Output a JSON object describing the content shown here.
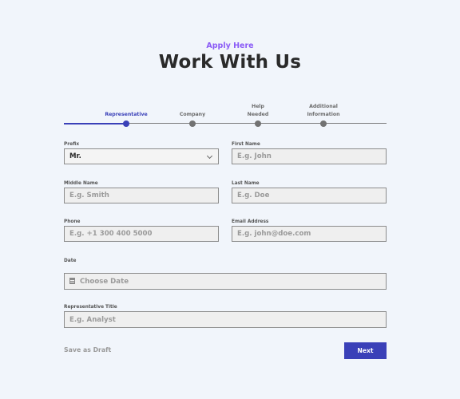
{
  "header": {
    "eyebrow": "Apply Here",
    "title": "Work With Us"
  },
  "stepper": {
    "progress_fraction": 0.195,
    "steps": [
      {
        "line1": "",
        "line2": "Representative",
        "active": true
      },
      {
        "line1": "",
        "line2": "Company",
        "active": false
      },
      {
        "line1": "Help",
        "line2": "Needed",
        "active": false
      },
      {
        "line1": "Additional",
        "line2": "Information",
        "active": false
      }
    ]
  },
  "form": {
    "prefix": {
      "label": "Prefix",
      "value": "Mr."
    },
    "first_name": {
      "label": "First Name",
      "placeholder": "E.g. John"
    },
    "middle_name": {
      "label": "Middle Name",
      "placeholder": "E.g. Smith"
    },
    "last_name": {
      "label": "Last Name",
      "placeholder": "E.g. Doe"
    },
    "phone": {
      "label": "Phone",
      "placeholder": "E.g. +1 300 400 5000"
    },
    "email": {
      "label": "Email Address",
      "placeholder": "E.g. john@doe.com"
    },
    "date": {
      "label": "Date",
      "placeholder": "Choose Date",
      "icon": "calendar-icon"
    },
    "rep_title": {
      "label": "Representative Title",
      "placeholder": "E.g. Analyst"
    }
  },
  "actions": {
    "draft_label": "Save as Draft",
    "next_label": "Next"
  },
  "colors": {
    "accent": "#3a40b8",
    "eyebrow": "#8b5cf6",
    "background": "#f1f5fb"
  }
}
